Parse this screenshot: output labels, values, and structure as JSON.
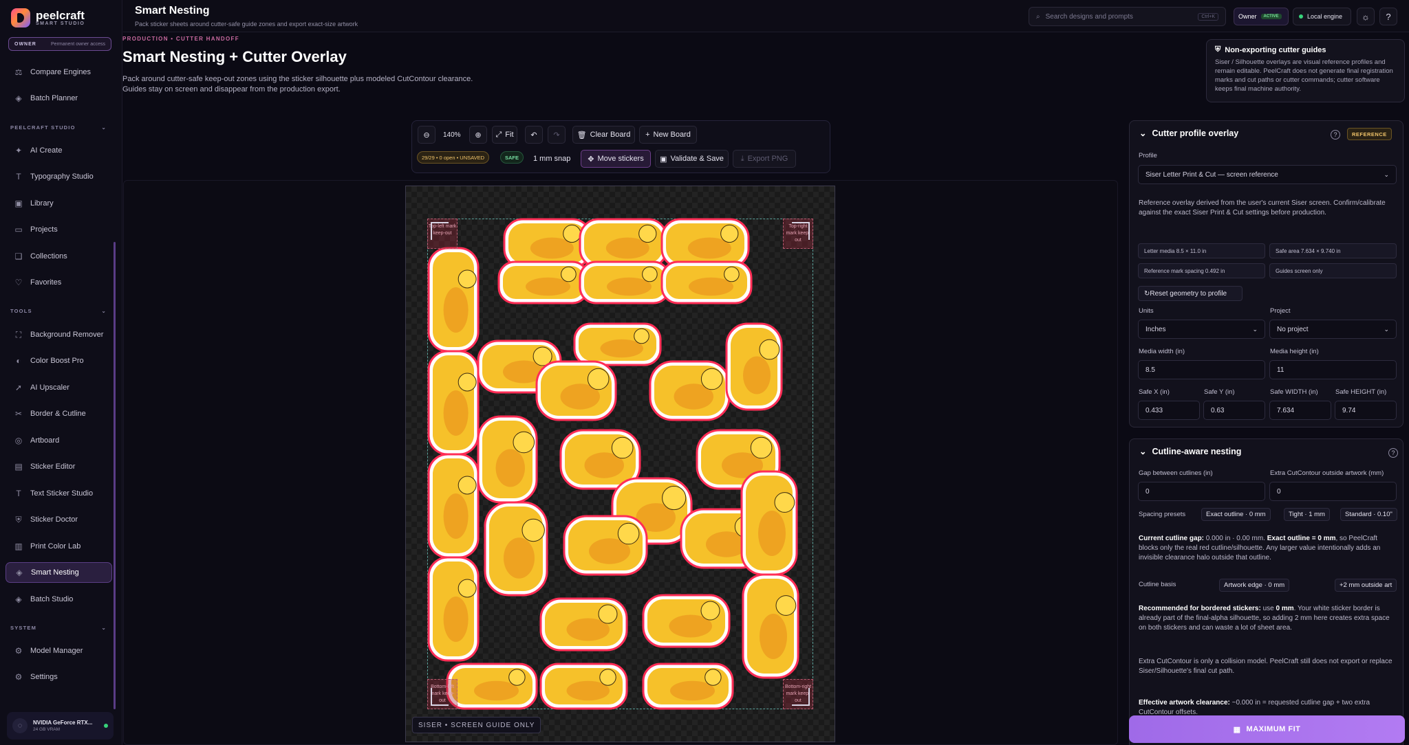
{
  "app": {
    "name": "peelcraft",
    "subtitle": "SMART STUDIO",
    "owner_label": "OWNER",
    "owner_value": "Permanent owner access"
  },
  "sidebar": {
    "top_items": [
      {
        "label": "Compare Engines",
        "icon": "compare-icon"
      },
      {
        "label": "Batch Planner",
        "icon": "layers-icon"
      }
    ],
    "sections": [
      {
        "title": "PEELCRAFT STUDIO",
        "items": [
          {
            "label": "AI Create",
            "icon": "sparkle-icon"
          },
          {
            "label": "Typography Studio",
            "icon": "type-icon"
          },
          {
            "label": "Library",
            "icon": "image-icon"
          },
          {
            "label": "Projects",
            "icon": "folder-icon"
          },
          {
            "label": "Collections",
            "icon": "collection-icon"
          },
          {
            "label": "Favorites",
            "icon": "heart-icon"
          }
        ]
      },
      {
        "title": "TOOLS",
        "items": [
          {
            "label": "Background Remover",
            "icon": "scan-icon"
          },
          {
            "label": "Color Boost Pro",
            "icon": "palette-icon"
          },
          {
            "label": "AI Upscaler",
            "icon": "rocket-icon"
          },
          {
            "label": "Border & Cutline",
            "icon": "scissors-icon"
          },
          {
            "label": "Artboard",
            "icon": "artboard-icon"
          },
          {
            "label": "Sticker Editor",
            "icon": "sticker-icon"
          },
          {
            "label": "Text Sticker Studio",
            "icon": "type-icon"
          },
          {
            "label": "Sticker Doctor",
            "icon": "shield-icon"
          },
          {
            "label": "Print Color Lab",
            "icon": "print-icon"
          },
          {
            "label": "Smart Nesting",
            "icon": "layers-icon",
            "active": true
          },
          {
            "label": "Batch Studio",
            "icon": "layers-icon"
          }
        ]
      },
      {
        "title": "SYSTEM",
        "items": [
          {
            "label": "Model Manager",
            "icon": "chip-icon"
          },
          {
            "label": "Settings",
            "icon": "gear-icon"
          }
        ]
      }
    ],
    "gpu": {
      "name": "NVIDIA GeForce RTX...",
      "vram": "24 GB VRAM"
    }
  },
  "topbar": {
    "title": "Smart Nesting",
    "subtitle": "Pack sticker sheets around cutter-safe guide zones and export exact-size artwork",
    "search_placeholder": "Search designs and prompts",
    "search_kbd": "Ctrl+K",
    "owner": "Owner",
    "active": "ACTIVE",
    "engine": "Local engine"
  },
  "header": {
    "kicker": "PRODUCTION • CUTTER HANDOFF",
    "title": "Smart Nesting + Cutter Overlay",
    "desc1": "Pack around cutter-safe keep-out zones using the sticker silhouette plus modeled CutContour clearance.",
    "desc2": "Guides stay on screen and disappear from the production export."
  },
  "toolbar": {
    "zoom": "140%",
    "fit": "Fit",
    "clear": "Clear Board",
    "new_board": "New Board",
    "status": "29/29 • 0 open • UNSAVED",
    "safe": "SAFE",
    "snap": "1 mm snap",
    "move": "Move stickers",
    "validate": "Validate & Save",
    "export": "Export PNG"
  },
  "board": {
    "marks": {
      "tl": "Top-left mark keep-out",
      "tr": "Top-right mark keep-out",
      "bl": "Bottom-left mark keep-out",
      "br": "Bottom-right mark keep-out"
    },
    "tag": "SISER • SCREEN GUIDE ONLY",
    "sticker_count": 29
  },
  "info": {
    "title": "Non-exporting cutter guides",
    "body": "Siser / Silhouette overlays are visual reference profiles and remain editable. PeelCraft does not generate final registration marks and cut paths or cutter commands; cutter software keeps final machine authority."
  },
  "profile_panel": {
    "title": "Cutter profile overlay",
    "badge": "REFERENCE",
    "profile_label": "Profile",
    "profile_value": "Siser Letter Print & Cut — screen reference",
    "note": "Reference overlay derived from the user's current Siser screen. Confirm/calibrate against the exact Siser Print & Cut settings before production.",
    "chips": [
      "Letter media 8.5 × 11.0 in",
      "Safe area 7.634 × 9.740 in",
      "Reference mark spacing 0.492 in",
      "Guides screen only"
    ],
    "reset": "Reset geometry to profile",
    "units_label": "Units",
    "units_value": "Inches",
    "project_label": "Project",
    "project_value": "No project",
    "mw_label": "Media width (in)",
    "mw_value": "8.5",
    "mh_label": "Media height (in)",
    "mh_value": "11",
    "sx_label": "Safe X (in)",
    "sx_value": "0.433",
    "sy_label": "Safe Y (in)",
    "sy_value": "0.63",
    "sw_label": "Safe WIDTH (in)",
    "sw_value": "7.634",
    "sh_label": "Safe HEIGHT (in)",
    "sh_value": "9.74"
  },
  "nesting_panel": {
    "title": "Cutline-aware nesting",
    "gap_label": "Gap between cutlines (in)",
    "gap_value": "0",
    "extra_label": "Extra CutContour outside artwork (mm)",
    "extra_value": "0",
    "presets_label": "Spacing presets",
    "presets": [
      "Exact outline · 0 mm",
      "Tight · 1 mm",
      "Standard · 0.10\""
    ],
    "current_b1": "Current cutline gap:",
    "current_t1": " 0.000 in · 0.00 mm. ",
    "current_b2": "Exact outline = 0 mm",
    "current_t2": ", so PeelCraft blocks only the real red cutline/silhouette. Any larger value intentionally adds an invisible clearance halo outside that outline.",
    "basis_label": "Cutline basis",
    "basis_options": [
      "Artwork edge · 0 mm",
      "+2 mm outside art"
    ],
    "rec_b1": "Recommended for bordered stickers:",
    "rec_t1": " use ",
    "rec_b2": "0 mm",
    "rec_t2": ". Your white sticker border is already part of the final-alpha silhouette, so adding 2 mm here creates extra space on both stickers and can waste a lot of sheet area.",
    "extra_note": "Extra CutContour is only a collision model. PeelCraft still does not export or replace Siser/Silhouette's final cut path.",
    "eff_b": "Effective artwork clearance:",
    "eff_t": " ~0.000 in = requested cutline gap + two extra CutContour offsets."
  },
  "footer": {
    "maxfit": "MAXIMUM FIT"
  },
  "colors": {
    "accent": "#b27bf2",
    "brand_pink": "#ff4d8d",
    "cutline": "#ff2d55",
    "sticker": "#f6c12a",
    "safe_guide": "#5aa19a"
  }
}
